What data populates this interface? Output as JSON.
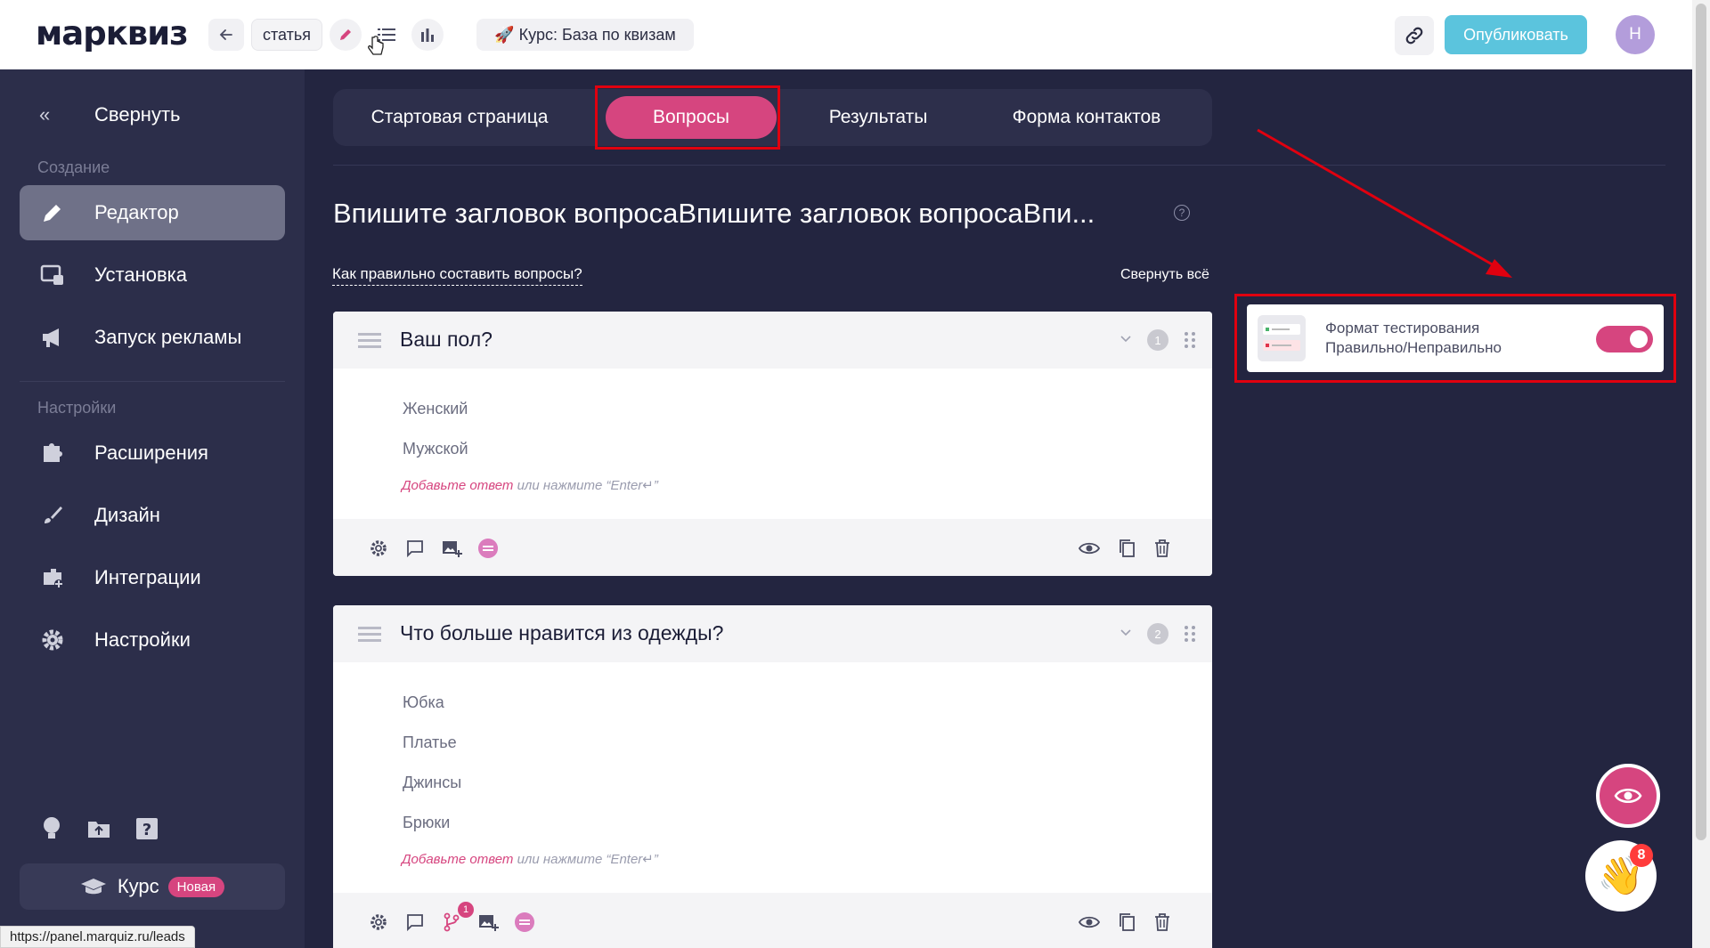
{
  "topbar": {
    "logo": "марквиз",
    "folder": "статья",
    "quiz_name": "🚀 Курс: База по квизам",
    "publish": "Опубликовать",
    "avatar": "Н"
  },
  "sidebar": {
    "collapse": "Свернуть",
    "section_create": "Создание",
    "items_create": [
      "Редактор",
      "Установка",
      "Запуск рекламы"
    ],
    "section_settings": "Настройки",
    "items_settings": [
      "Расширения",
      "Дизайн",
      "Интеграции",
      "Настройки"
    ],
    "course": "Курс",
    "course_badge": "Новая"
  },
  "status_url": "https://panel.marquiz.ru/leads",
  "tabs": [
    "Стартовая страница",
    "Вопросы",
    "Результаты",
    "Форма контактов"
  ],
  "main": {
    "title": "Впишите загловок вопросаВпишите загловок вопросаВпи...",
    "how_link": "Как правильно составить вопросы?",
    "collapse_all": "Свернуть всё",
    "add_answer": "Добавьте ответ",
    "add_answer_hint": " или нажмите “Enter↵”"
  },
  "questions": [
    {
      "number": "1",
      "title": "Ваш пол?",
      "answers": [
        "Женский",
        "Мужской"
      ]
    },
    {
      "number": "2",
      "title": "Что больше нравится из одежды?",
      "answers": [
        "Юбка",
        "Платье",
        "Джинсы",
        "Брюки"
      ],
      "branch_count": "1"
    }
  ],
  "side_card": {
    "line1": "Формат тестирования",
    "line2": "Правильно/Неправильно",
    "enabled": true
  },
  "chat_badge": "8",
  "colors": {
    "accent": "#d6457f",
    "publish": "#5bc4dd",
    "bg": "#232540",
    "sidebar": "#2c2e4a"
  }
}
